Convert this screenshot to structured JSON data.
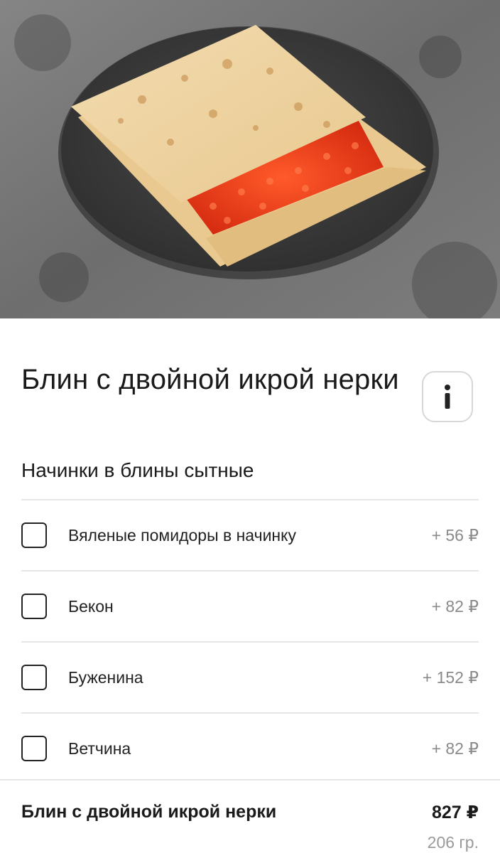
{
  "product": {
    "image_alt": "pancake-with-red-caviar-photo",
    "title": "Блин с двойной икрой нерки",
    "info_icon": "info-icon"
  },
  "toppings": {
    "section_title": "Начинки в блины сытные",
    "items": [
      {
        "label": "Вяленые помидоры в начинку",
        "price": "+ 56 ₽",
        "checked": false
      },
      {
        "label": "Бекон",
        "price": "+ 82 ₽",
        "checked": false
      },
      {
        "label": "Буженина",
        "price": "+ 152 ₽",
        "checked": false
      },
      {
        "label": "Ветчина",
        "price": "+ 82 ₽",
        "checked": false
      }
    ]
  },
  "summary": {
    "name": "Блин с двойной икрой нерки",
    "price": "827 ₽",
    "weight": "206 гр."
  },
  "colors": {
    "caviar": "#e8361b",
    "plate": "#3d3d3d",
    "background_stone": "#7a7a7a",
    "border": "#e6e6e6"
  }
}
